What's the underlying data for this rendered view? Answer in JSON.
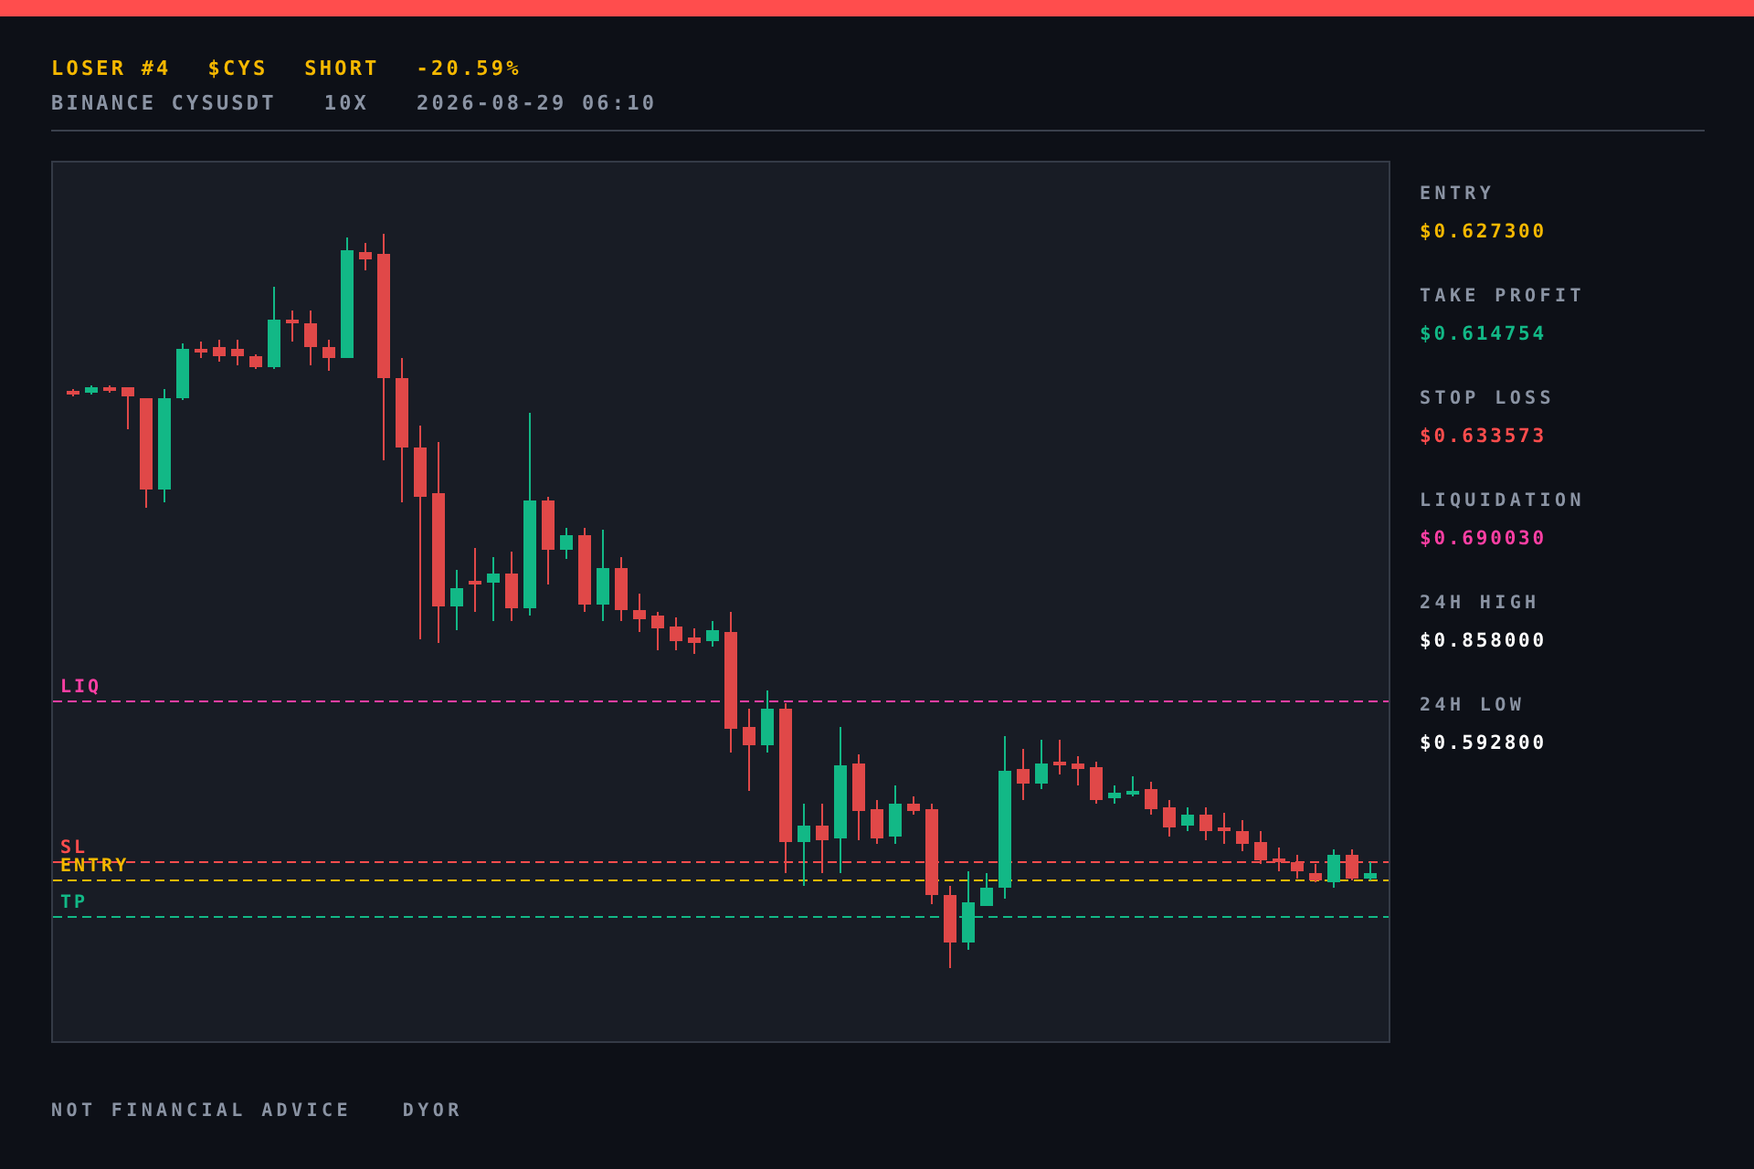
{
  "header": {
    "headline": [
      "LOSER #4",
      "$CYS",
      "SHORT",
      "-20.59%"
    ],
    "details": [
      "BINANCE CYSUSDT",
      "10X",
      "2026-08-29 06:10"
    ]
  },
  "chart": {
    "levels": [
      {
        "kind": "liquidation",
        "label": "LIQ",
        "color": "#ff3fa4"
      },
      {
        "kind": "stop_loss",
        "label": "SL",
        "color": "#ff4d4d"
      },
      {
        "kind": "entry",
        "label": "ENTRY",
        "color": "#f5b800"
      },
      {
        "kind": "take_profit",
        "label": "TP",
        "color": "#12b886"
      }
    ]
  },
  "stats": [
    {
      "label": "ENTRY",
      "value": "$0.627300",
      "color": "#f5b800"
    },
    {
      "label": "TAKE PROFIT",
      "value": "$0.614754",
      "color": "#12b886"
    },
    {
      "label": "STOP LOSS",
      "value": "$0.633573",
      "color": "#ff4d4d"
    },
    {
      "label": "LIQUIDATION",
      "value": "$0.690030",
      "color": "#ff3fa4"
    },
    {
      "label": "24H HIGH",
      "value": "$0.858000",
      "color": "#ffffff"
    },
    {
      "label": "24H LOW",
      "value": "$0.592800",
      "color": "#ffffff"
    }
  ],
  "footer": [
    "NOT FINANCIAL ADVICE",
    "DYOR"
  ]
}
